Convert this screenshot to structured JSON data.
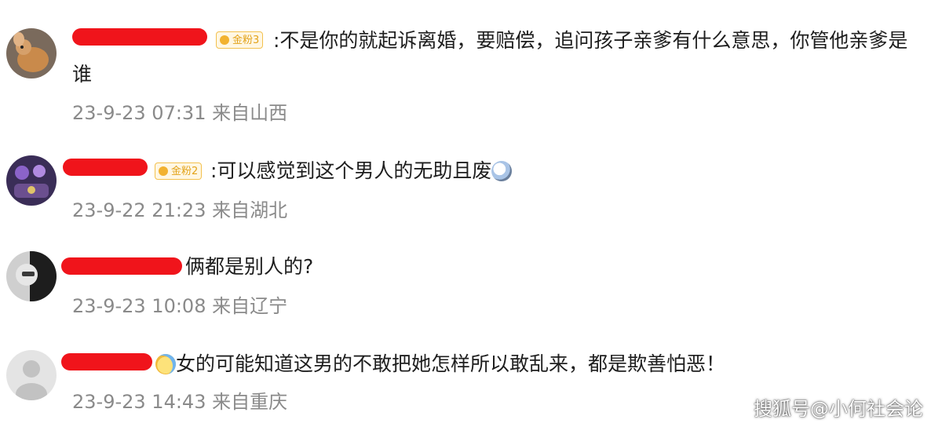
{
  "comments": [
    {
      "badge": "金粉3",
      "text_line1": ":不是你的就起诉离婚，要赔偿，追问孩子亲爹有什么意思，你管他亲爹是",
      "text_line2": "谁",
      "date": "23-9-23 07:31",
      "location": "来自山西"
    },
    {
      "badge": "金粉2",
      "text_line1": ":可以感觉到这个男人的无助且废",
      "date": "23-9-22 21:23",
      "location": "来自湖北"
    },
    {
      "text_line1": "俩都是别人的?",
      "date": "23-9-23 10:08",
      "location": "来自辽宁"
    },
    {
      "text_line1": "女的可能知道这男的不敢把她怎样所以敢乱来，都是欺善怕恶！",
      "date": "23-9-23 14:43",
      "location": "来自重庆"
    }
  ],
  "watermark": "搜狐号@小何社会论",
  "colors": {
    "redaction": "#f0141b",
    "meta_text": "#8a8a8a",
    "badge_gold": "#f2b230"
  }
}
